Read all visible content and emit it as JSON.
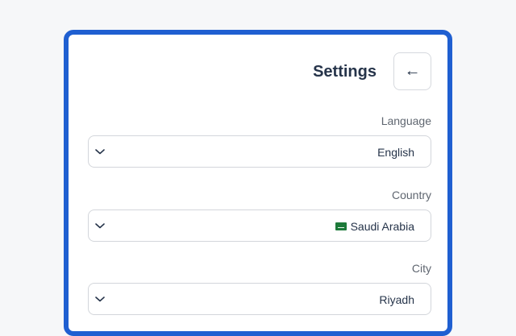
{
  "header": {
    "title": "Settings",
    "back_icon": "←"
  },
  "fields": {
    "language": {
      "label": "Language",
      "value": "English"
    },
    "country": {
      "label": "Country",
      "value": "Saudi Arabia",
      "flag": "saudi-flag-icon"
    },
    "city": {
      "label": "City",
      "value": "Riyadh"
    }
  },
  "colors": {
    "card_border": "#1f5fd1",
    "text_primary": "#26344a",
    "label": "#5f6670",
    "background": "#f6f7f9"
  }
}
